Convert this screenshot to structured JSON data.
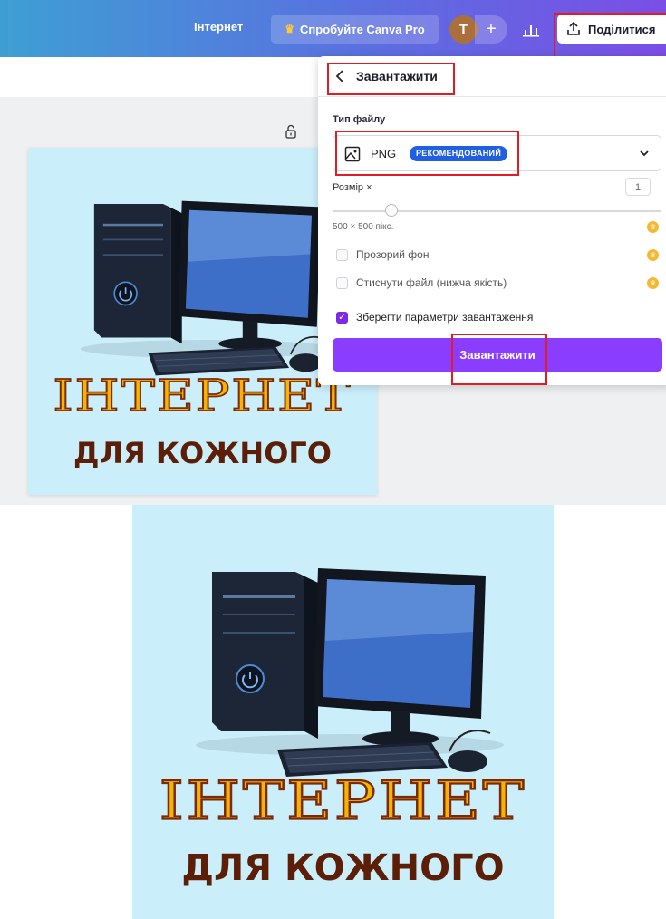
{
  "header": {
    "design_title": "Інтернет",
    "pro_button": "Спробуйте Canva Pro",
    "avatar_initial": "T",
    "add_label": "+",
    "share_button": "Поділитися"
  },
  "download_panel": {
    "title": "Завантажити",
    "file_type_label": "Тип файлу",
    "file_type_value": "PNG",
    "file_type_badge": "РЕКОМЕНДОВАНИЙ",
    "size_label": "Розмір ×",
    "size_value": "1",
    "dimensions": "500 × 500 пікс.",
    "options": [
      {
        "label": "Прозорий фон",
        "checked": false,
        "pro": true
      },
      {
        "label": "Стиснути файл (нижча якість)",
        "checked": false,
        "pro": true
      },
      {
        "label": "Зберегти параметри завантаження",
        "checked": true,
        "pro": false
      }
    ],
    "download_button": "Завантажити"
  },
  "design": {
    "headline": "ІНТЕРНЕТ",
    "subline": "ДЛЯ КОЖНОГО"
  },
  "colors": {
    "accent": "#8b3dff",
    "badge": "#1f5fe0",
    "design_bg": "#cbeefb",
    "headline": "#f5b400",
    "headline_outline": "#7a2a0a",
    "subline": "#5c1e07",
    "highlight": "#e31b23"
  }
}
